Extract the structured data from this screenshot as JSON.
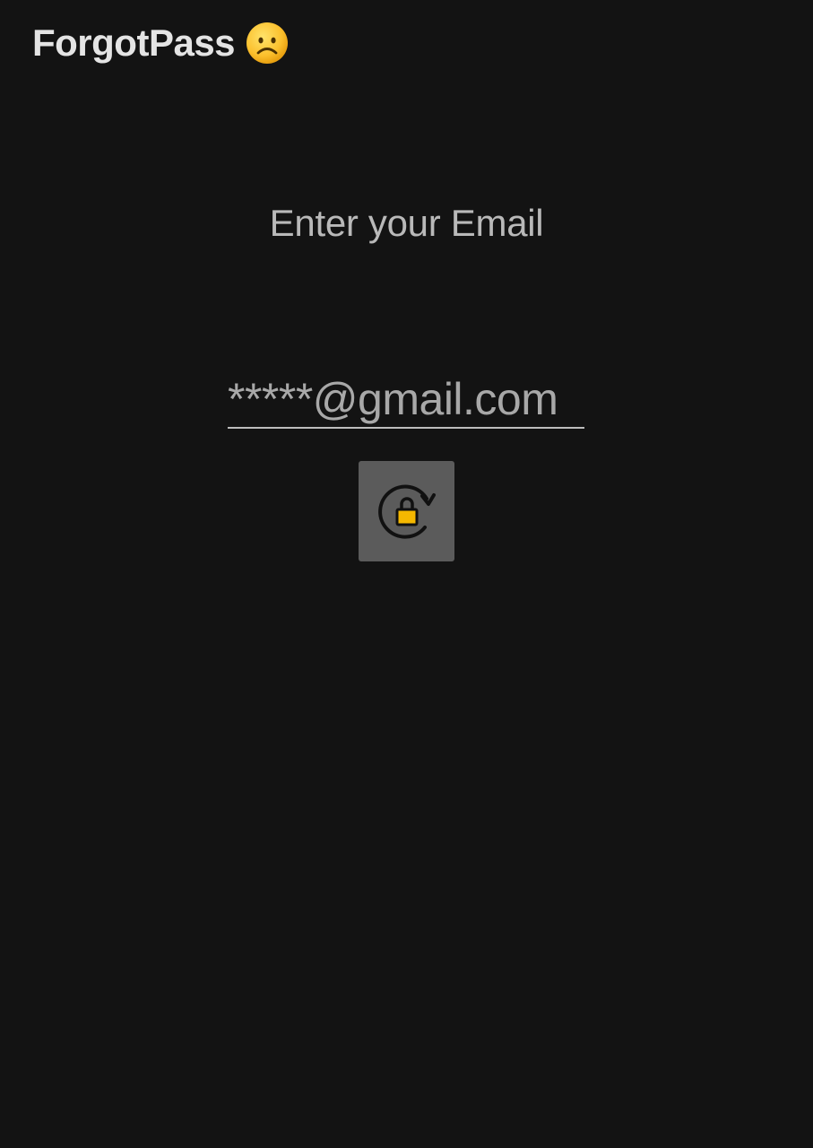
{
  "header": {
    "title": "ForgotPass",
    "emoji_icon": "frowning-face-icon"
  },
  "form": {
    "prompt": "Enter your Email",
    "email_value": "*****@gmail.com",
    "submit_icon": "lock-reset-icon"
  },
  "colors": {
    "background": "#131313",
    "button_bg": "#5b5b5b",
    "lock_accent": "#f5b800"
  }
}
